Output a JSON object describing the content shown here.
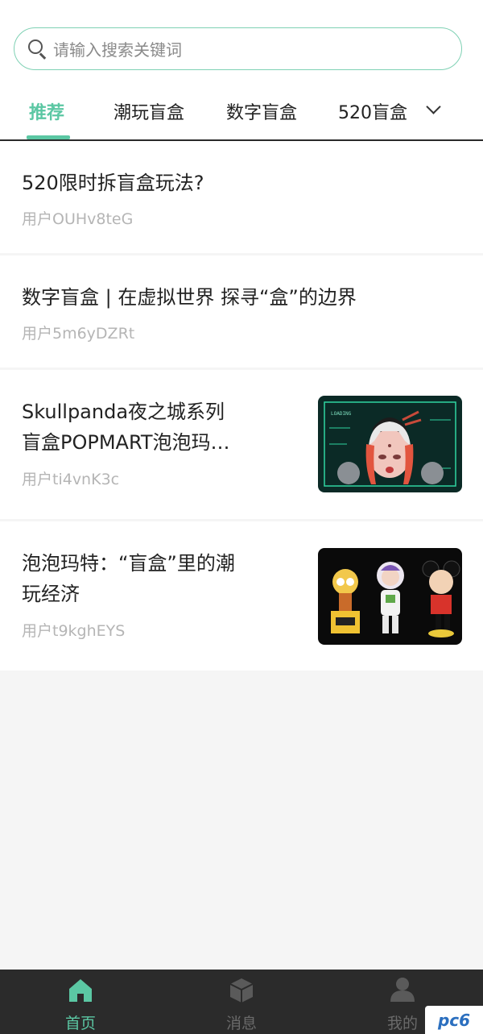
{
  "search": {
    "placeholder": "请输入搜索关键词"
  },
  "tabs": [
    {
      "label": "推荐",
      "active": true
    },
    {
      "label": "潮玩盲盒"
    },
    {
      "label": "数字盲盒"
    },
    {
      "label": "520盲盒"
    }
  ],
  "feed": [
    {
      "title": "520限时拆盲盒玩法?",
      "author": "用户OUHv8teG"
    },
    {
      "title": "数字盲盒 | 在虚拟世界 探寻“盒”的边界",
      "author": "用户5m6yDZRt"
    },
    {
      "title_line1": "Skullpanda夜之城系列",
      "title_line2": "盲盒POPMART泡泡玛…",
      "author": "用户ti4vnK3c",
      "thumb_text": "LOADING"
    },
    {
      "title_line1": "泡泡玛特：“盲盒”里的潮",
      "title_line2": "玩经济",
      "author": "用户t9kghEYS"
    }
  ],
  "bottom_nav": [
    {
      "label": "首页",
      "icon": "home-icon",
      "active": true
    },
    {
      "label": "消息",
      "icon": "cube-icon"
    },
    {
      "label": "我的",
      "icon": "user-icon"
    }
  ],
  "watermark": "pc6",
  "colors": {
    "accent": "#5bc7a3",
    "nav_bg": "#2b2b2b",
    "muted": "#b5b5b5"
  }
}
